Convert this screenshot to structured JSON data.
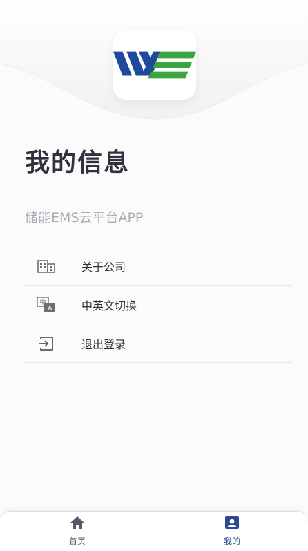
{
  "header": {
    "title": "我的信息",
    "subtitle": "储能EMS云平台APP"
  },
  "menu": {
    "items": [
      {
        "label": "关于公司",
        "icon": "building-icon"
      },
      {
        "label": "中英文切换",
        "icon": "language-switch-icon"
      },
      {
        "label": "退出登录",
        "icon": "logout-icon"
      }
    ]
  },
  "tabbar": {
    "tabs": [
      {
        "label": "首页",
        "icon": "home-icon",
        "active": false
      },
      {
        "label": "我的",
        "icon": "user-profile-icon",
        "active": true
      }
    ]
  },
  "colors": {
    "logo_blue": "#1f4a9c",
    "logo_green": "#3aa53f",
    "active_tab": "#2b4a8f"
  }
}
